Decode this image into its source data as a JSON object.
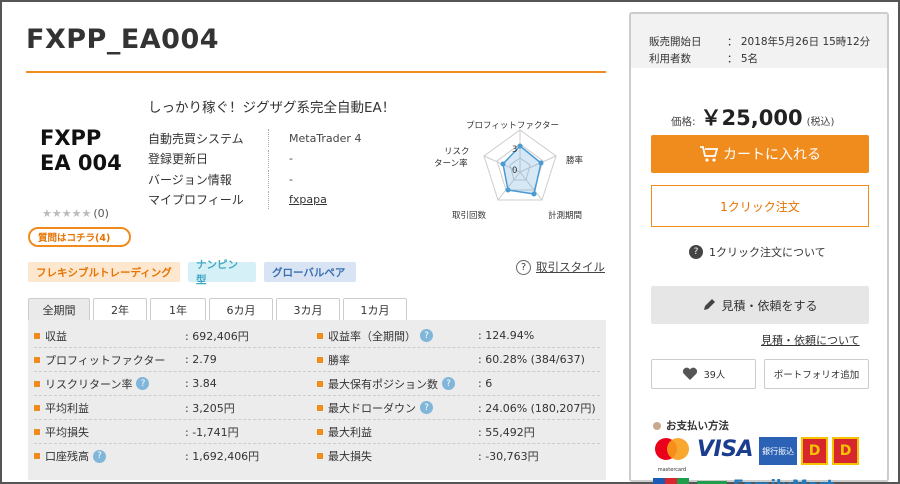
{
  "header": {
    "title": "FXPP_EA004",
    "catchphrase": "しっかり稼ぐ！ジグザグ系完全自動EA！",
    "logo_line1": "FXPP",
    "logo_line2": "EA 004"
  },
  "info": [
    {
      "key": "自動売買システム",
      "value": "MetaTrader 4"
    },
    {
      "key": "登録更新日",
      "value": "-"
    },
    {
      "key": "バージョン情報",
      "value": "-"
    },
    {
      "key": "マイプロフィール",
      "value": "fxpapa"
    }
  ],
  "rating": {
    "stars": "★★★★★",
    "count": "(0)",
    "star_value": 0
  },
  "question_button": "質問はコチラ(4)",
  "tags": [
    "フレキシブルトレーディング",
    "ナンピン型",
    "グローバルペア"
  ],
  "trade_style": {
    "icon": "question-circle-icon",
    "label": "取引スタイル"
  },
  "radar": {
    "labels": [
      "プロフィットファクター",
      "勝率",
      "計測期間",
      "取引回数",
      "リスク",
      "ターン率"
    ],
    "scale_labels": [
      "3",
      "0"
    ],
    "values": {
      "profit_factor": 3,
      "win_rate": 2,
      "period": 1,
      "trades": 1,
      "risk_return": 1.5
    }
  },
  "tabs": [
    "全期間",
    "2年",
    "1年",
    "6カ月",
    "3カ月",
    "1カ月"
  ],
  "stats": [
    [
      {
        "key": "収益",
        "value": ": 692,406円",
        "help": false
      },
      {
        "key": "収益率（全期間）",
        "value": ": 124.94%",
        "help": true
      }
    ],
    [
      {
        "key": "プロフィットファクター",
        "value": ": 2.79",
        "help": false
      },
      {
        "key": "勝率",
        "value": ": 60.28% (384/637)",
        "help": false
      }
    ],
    [
      {
        "key": "リスクリターン率",
        "value": ": 3.84",
        "help": true
      },
      {
        "key": "最大保有ポジション数",
        "value": ": 6",
        "help": true
      }
    ],
    [
      {
        "key": "平均利益",
        "value": ": 3,205円",
        "help": false
      },
      {
        "key": "最大ドローダウン",
        "value": ": 24.06% (180,207円)",
        "help": true
      }
    ],
    [
      {
        "key": "平均損失",
        "value": ": -1,741円",
        "help": false
      },
      {
        "key": "最大利益",
        "value": ": 55,492円",
        "help": false
      }
    ],
    [
      {
        "key": "口座残高",
        "value": ": 1,692,406円",
        "help": true
      },
      {
        "key": "最大損失",
        "value": ": -30,763円",
        "help": false
      }
    ]
  ],
  "sidebar": {
    "sale_start_label": "販売開始日",
    "sale_start_value": "：  2018年5月26日 15時12分",
    "users_label": "利用者数",
    "users_value": "：  5名",
    "price_label": "価格:",
    "price_value": "￥25,000",
    "price_tax": "(税込)",
    "cart_button": "カートに入れる",
    "oneclick_button": "1クリック注文",
    "oneclick_about": "1クリック注文について",
    "quote_button": "見積・依頼をする",
    "quote_about": "見積・依頼について",
    "fav_count": "39人",
    "portfolio_button": "ポートフォリオ追加",
    "payment_title": "お支払い方法",
    "visa": "VISA",
    "bank": "銀行振込",
    "mastercard": "mastercard",
    "daily": "Daily",
    "familymart": "FamilyMart"
  }
}
